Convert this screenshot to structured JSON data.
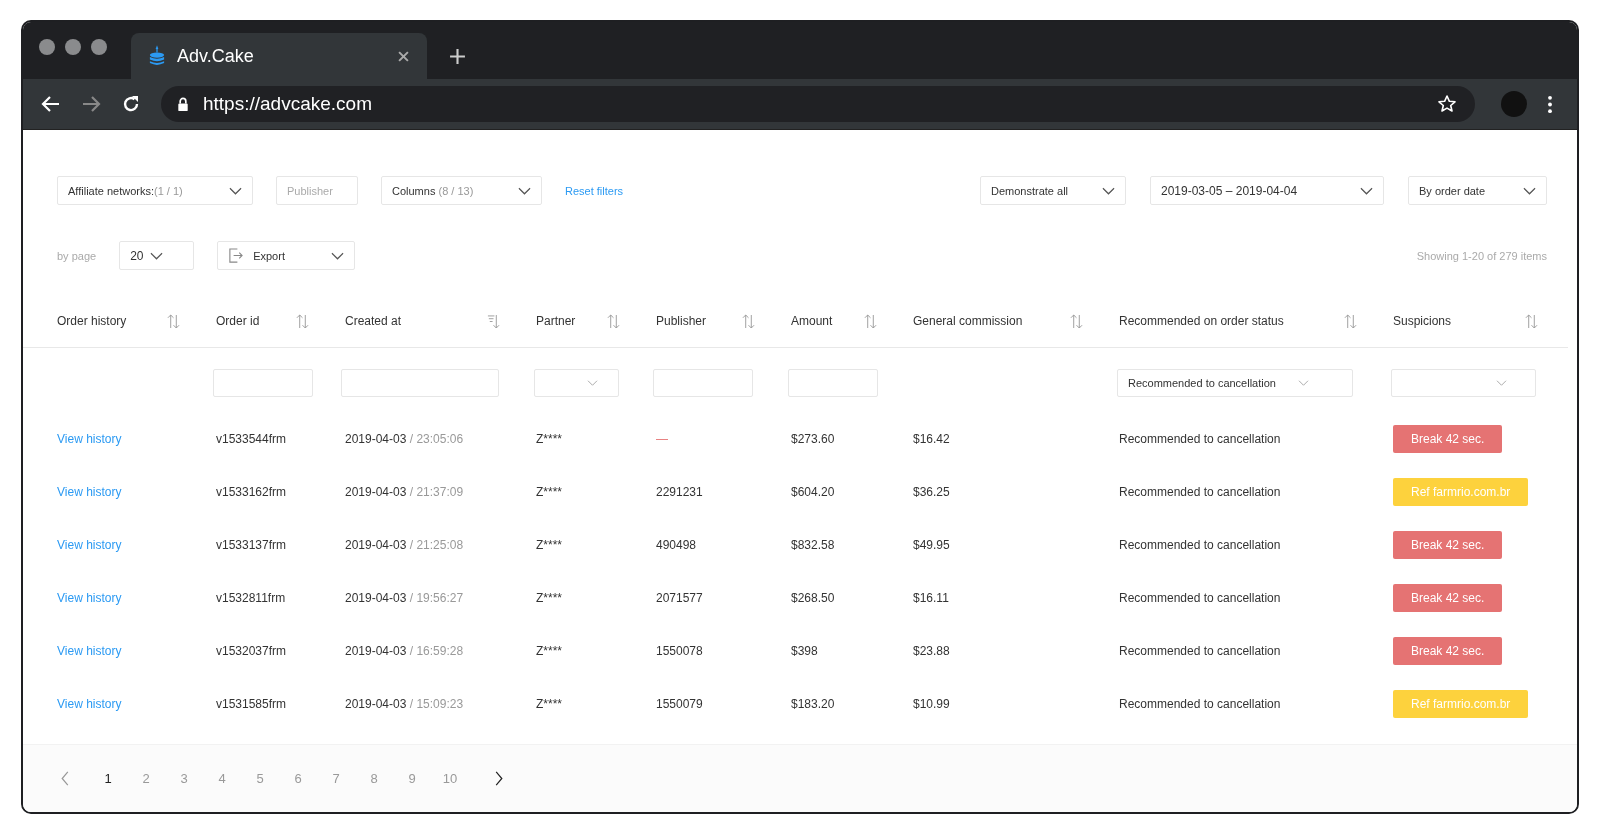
{
  "browser": {
    "tab_title": "Adv.Cake",
    "url": "https://advcake.com",
    "forward_disabled": true
  },
  "filters_left": [
    {
      "kind": "select",
      "label": "Affiliate networks:",
      "count": "(1 / 1)"
    },
    {
      "kind": "input",
      "placeholder": "Publisher"
    },
    {
      "kind": "select",
      "label": "Columns",
      "count": "(8 / 13)"
    },
    {
      "kind": "link",
      "label": "Reset filters"
    }
  ],
  "filters_right": [
    {
      "kind": "select",
      "label": "Demonstrate all"
    },
    {
      "kind": "select",
      "label": "2019-03-05 – 2019-04-04"
    },
    {
      "kind": "select",
      "label": "By order date"
    }
  ],
  "per_page": {
    "label": "by page",
    "value": "20"
  },
  "export": {
    "label": "Export"
  },
  "showing": "Showing 1-20 of 279 items",
  "table": {
    "columns": [
      {
        "label": "Order history",
        "sorted_desc": false
      },
      {
        "label": "Order id",
        "sorted_desc": false
      },
      {
        "label": "Created at",
        "sorted_desc": true
      },
      {
        "label": "Partner",
        "sorted_desc": false
      },
      {
        "label": "Publisher",
        "sorted_desc": false
      },
      {
        "label": "Amount",
        "sorted_desc": false
      },
      {
        "label": "General commission",
        "sorted_desc": false
      },
      {
        "label": "Recommended on order status",
        "sorted_desc": false
      },
      {
        "label": "Suspicions",
        "sorted_desc": false
      }
    ],
    "filters": [
      {
        "kind": "blank"
      },
      {
        "kind": "input"
      },
      {
        "kind": "input"
      },
      {
        "kind": "select"
      },
      {
        "kind": "input"
      },
      {
        "kind": "input"
      },
      {
        "kind": "blank"
      },
      {
        "kind": "select",
        "value": "Recommended to cancellation"
      },
      {
        "kind": "select"
      }
    ],
    "rows": [
      {
        "link": "View history",
        "order_id": "v1533544frm",
        "date": "2019-04-03",
        "time": "/ 23:05:06",
        "partner": "Z****",
        "publisher": "—",
        "publisher_empty": true,
        "amount": "$273.60",
        "commission": "$16.42",
        "status": "Recommended to cancellation",
        "suspicion": "Break 42 sec.",
        "color": "#e57373"
      },
      {
        "link": "View history",
        "order_id": "v1533162frm",
        "date": "2019-04-03",
        "time": "/ 21:37:09",
        "partner": "Z****",
        "publisher": "2291231",
        "publisher_empty": false,
        "amount": "$604.20",
        "commission": "$36.25",
        "status": "Recommended to cancellation",
        "suspicion": "Ref farmrio.com.br",
        "color": "#fdd23d"
      },
      {
        "link": "View history",
        "order_id": "v1533137frm",
        "date": "2019-04-03",
        "time": "/ 21:25:08",
        "partner": "Z****",
        "publisher": "490498",
        "publisher_empty": false,
        "amount": "$832.58",
        "commission": "$49.95",
        "status": "Recommended to cancellation",
        "suspicion": "Break 42 sec.",
        "color": "#e57373"
      },
      {
        "link": "View history",
        "order_id": "v1532811frm",
        "date": "2019-04-03",
        "time": "/ 19:56:27",
        "partner": "Z****",
        "publisher": "2071577",
        "publisher_empty": false,
        "amount": "$268.50",
        "commission": "$16.11",
        "status": "Recommended to cancellation",
        "suspicion": "Break 42 sec.",
        "color": "#e57373"
      },
      {
        "link": "View history",
        "order_id": "v1532037frm",
        "date": "2019-04-03",
        "time": "/ 16:59:28",
        "partner": "Z****",
        "publisher": "1550078",
        "publisher_empty": false,
        "amount": "$398",
        "commission": "$23.88",
        "status": "Recommended to cancellation",
        "suspicion": "Break 42 sec.",
        "color": "#e57373"
      },
      {
        "link": "View history",
        "order_id": "v1531585frm",
        "date": "2019-04-03",
        "time": "/ 15:09:23",
        "partner": "Z****",
        "publisher": "1550079",
        "publisher_empty": false,
        "amount": "$183.20",
        "commission": "$10.99",
        "status": "Recommended to cancellation",
        "suspicion": "Ref farmrio.com.br",
        "color": "#fdd23d"
      }
    ]
  },
  "pagination": [
    {
      "label": "1",
      "selected": true
    },
    {
      "label": "2",
      "selected": false
    },
    {
      "label": "3",
      "selected": false
    },
    {
      "label": "4",
      "selected": false
    },
    {
      "label": "5",
      "selected": false
    },
    {
      "label": "6",
      "selected": false
    },
    {
      "label": "7",
      "selected": false
    },
    {
      "label": "8",
      "selected": false
    },
    {
      "label": "9",
      "selected": false
    },
    {
      "label": "10",
      "selected": false
    }
  ]
}
